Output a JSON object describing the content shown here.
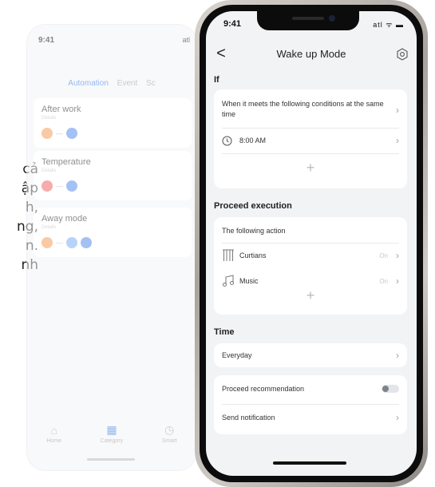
{
  "side_text": {
    "lines": [
      "cả",
      "ập",
      "h,",
      "ng,",
      "n.",
      "nh"
    ]
  },
  "background_screen": {
    "status_time": "9:41",
    "status_right": "atl",
    "tabs": [
      "Automation",
      "Event",
      "Sc"
    ],
    "cards": [
      {
        "title": "After work",
        "subtitle": "Details"
      },
      {
        "title": "Temperature",
        "subtitle": "Details"
      },
      {
        "title": "Away mode",
        "subtitle": "Details"
      }
    ],
    "nav": [
      {
        "label": "Home",
        "icon": "home-icon"
      },
      {
        "label": "Category",
        "icon": "grid-icon"
      },
      {
        "label": "Smart",
        "icon": "clock-icon"
      }
    ]
  },
  "status_bar": {
    "time": "9:41",
    "icons": "atl ᯤ ▬"
  },
  "header": {
    "back": "<",
    "title": "Wake up Mode",
    "settings_icon": "gear-icon"
  },
  "if_section": {
    "label": "If",
    "condition_text": "When it meets the following conditions at the same time",
    "time": "8:00 AM",
    "add": "+"
  },
  "execution_section": {
    "label": "Proceed execution",
    "action_header": "The following action",
    "actions": [
      {
        "label": "Curtians",
        "status": "On",
        "icon": "curtain-icon"
      },
      {
        "label": "Music",
        "status": "On",
        "icon": "music-icon"
      }
    ],
    "add": "+"
  },
  "time_section": {
    "label": "Time",
    "repeat": "Everyday"
  },
  "options": {
    "recommendation": "Proceed recommendation",
    "recommendation_enabled": false,
    "notification": "Send notification"
  },
  "colors": {
    "accent": "#3c7de6",
    "screen_bg": "#f2f3f5",
    "card_bg": "#ffffff",
    "dot_orange": "#f5a05a",
    "dot_blue": "#5b8ff0",
    "dot_red": "#ef6a6a"
  }
}
